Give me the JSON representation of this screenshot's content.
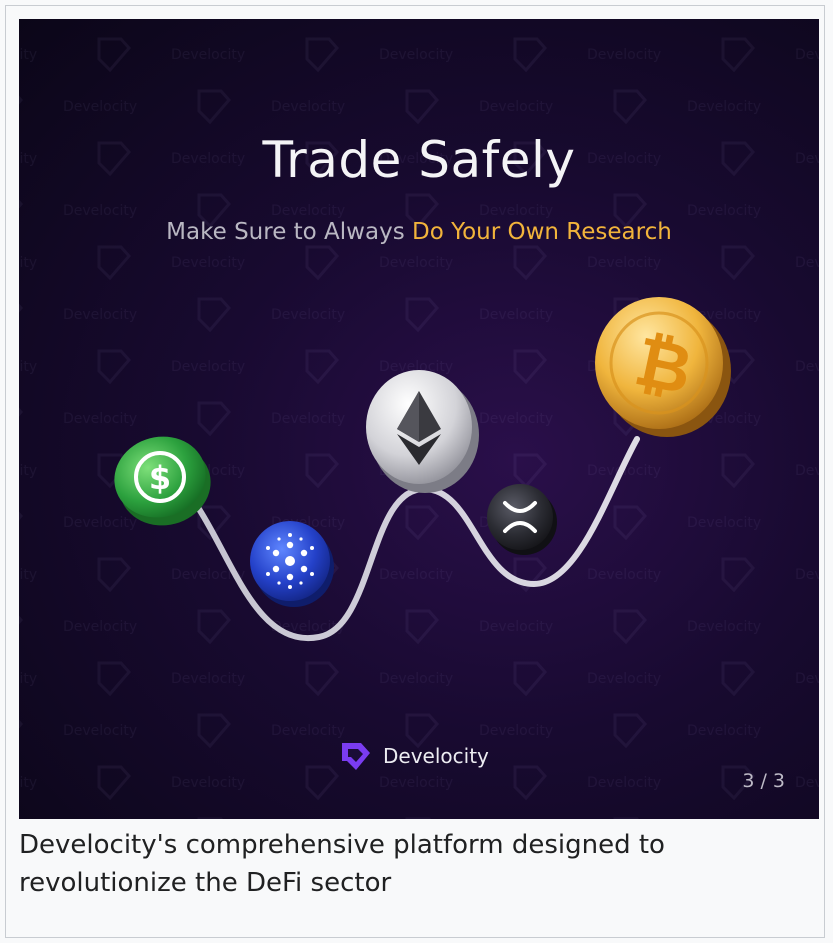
{
  "image": {
    "headline": "Trade Safely",
    "subline_prefix": "Make Sure to Always ",
    "subline_highlight": "Do Your Own Research",
    "brand_name": "Develocity",
    "watermark_text": "Develocity",
    "page_indicator": "3 / 3",
    "coins": [
      {
        "name": "usdc",
        "color": "#35b84a"
      },
      {
        "name": "cardano",
        "color": "#2b4fd6"
      },
      {
        "name": "ethereum",
        "color": "#d9d9de"
      },
      {
        "name": "xrp",
        "color": "#2e2f36"
      },
      {
        "name": "bitcoin",
        "color": "#e9a72f"
      }
    ],
    "colors": {
      "highlight": "#f2b43b",
      "brand_logo": "#7a3cf0",
      "background": "#120826"
    }
  },
  "caption": "Develocity's comprehensive platform designed to revolutionize the DeFi sector"
}
